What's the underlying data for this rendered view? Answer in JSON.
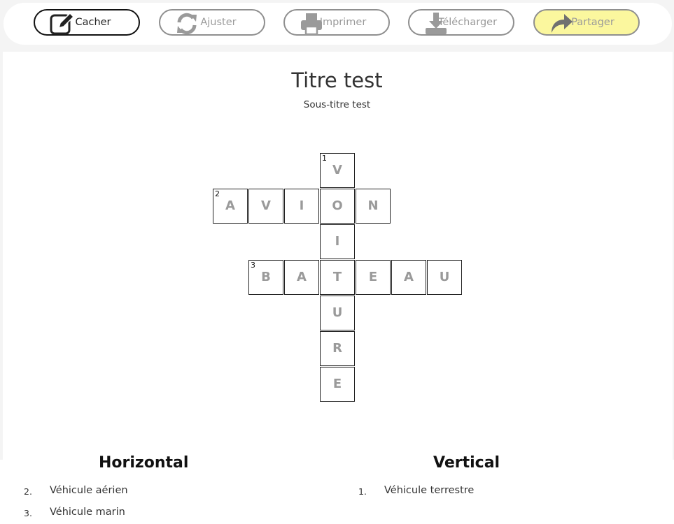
{
  "toolbar": {
    "buttons": [
      {
        "label": "Cacher",
        "icon": "edit-icon"
      },
      {
        "label": "Ajuster",
        "icon": "refresh-icon"
      },
      {
        "label": "Imprimer",
        "icon": "printer-icon"
      },
      {
        "label": "Télécharger",
        "icon": "download-icon"
      },
      {
        "label": "Partager",
        "icon": "share-icon"
      }
    ]
  },
  "puzzle": {
    "title": "Titre test",
    "subtitle": "Sous-titre test",
    "grid": {
      "cols": 7,
      "rows": 7,
      "cells": [
        {
          "r": 0,
          "c": 3,
          "letter": "V",
          "num": "1"
        },
        {
          "r": 1,
          "c": 0,
          "letter": "A",
          "num": "2"
        },
        {
          "r": 1,
          "c": 1,
          "letter": "V"
        },
        {
          "r": 1,
          "c": 2,
          "letter": "I"
        },
        {
          "r": 1,
          "c": 3,
          "letter": "O"
        },
        {
          "r": 1,
          "c": 4,
          "letter": "N"
        },
        {
          "r": 2,
          "c": 3,
          "letter": "I"
        },
        {
          "r": 3,
          "c": 1,
          "letter": "B",
          "num": "3"
        },
        {
          "r": 3,
          "c": 2,
          "letter": "A"
        },
        {
          "r": 3,
          "c": 3,
          "letter": "T"
        },
        {
          "r": 3,
          "c": 4,
          "letter": "E"
        },
        {
          "r": 3,
          "c": 5,
          "letter": "A"
        },
        {
          "r": 3,
          "c": 6,
          "letter": "U"
        },
        {
          "r": 4,
          "c": 3,
          "letter": "U"
        },
        {
          "r": 5,
          "c": 3,
          "letter": "R"
        },
        {
          "r": 6,
          "c": 3,
          "letter": "E"
        }
      ]
    }
  },
  "clues": {
    "horizontal": {
      "heading": "Horizontal",
      "items": [
        {
          "num": "2.",
          "text": "Véhicule aérien"
        },
        {
          "num": "3.",
          "text": "Véhicule marin"
        }
      ]
    },
    "vertical": {
      "heading": "Vertical",
      "items": [
        {
          "num": "1.",
          "text": "Véhicule terrestre"
        }
      ]
    }
  }
}
